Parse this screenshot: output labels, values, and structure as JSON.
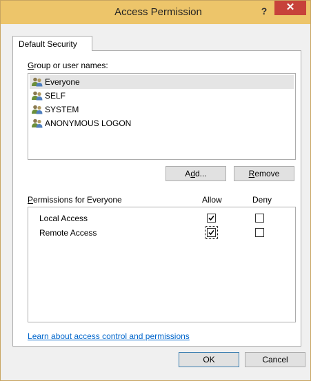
{
  "window": {
    "title": "Access Permission",
    "help_label": "?",
    "close_label": "✕"
  },
  "tabs": [
    {
      "label": "Default Security",
      "active": true
    }
  ],
  "groups": {
    "label_prefix": "",
    "label_accel": "G",
    "label_rest": "roup or user names:",
    "items": [
      {
        "name": "Everyone",
        "selected": true
      },
      {
        "name": "SELF",
        "selected": false
      },
      {
        "name": "SYSTEM",
        "selected": false
      },
      {
        "name": "ANONYMOUS LOGON",
        "selected": false
      }
    ]
  },
  "buttons": {
    "add_prefix": "A",
    "add_accel": "d",
    "add_rest": "d...",
    "remove_accel": "R",
    "remove_rest": "emove",
    "ok": "OK",
    "cancel": "Cancel"
  },
  "permissions": {
    "label_accel": "P",
    "label_rest": "ermissions for Everyone",
    "col_allow": "Allow",
    "col_deny": "Deny",
    "rows": [
      {
        "name": "Local Access",
        "allow": true,
        "deny": false
      },
      {
        "name": "Remote Access",
        "allow": true,
        "deny": false
      }
    ]
  },
  "link": {
    "accel": "L",
    "rest": "earn about access control and permissions"
  },
  "icons": {
    "group_users": "users-group-icon",
    "help": "help-icon",
    "close": "close-icon",
    "check": "checkmark-icon"
  },
  "colors": {
    "titlebar": "#edc56a",
    "close_button": "#c7423a",
    "link": "#0066cc",
    "selection": "#e5e5e5"
  }
}
